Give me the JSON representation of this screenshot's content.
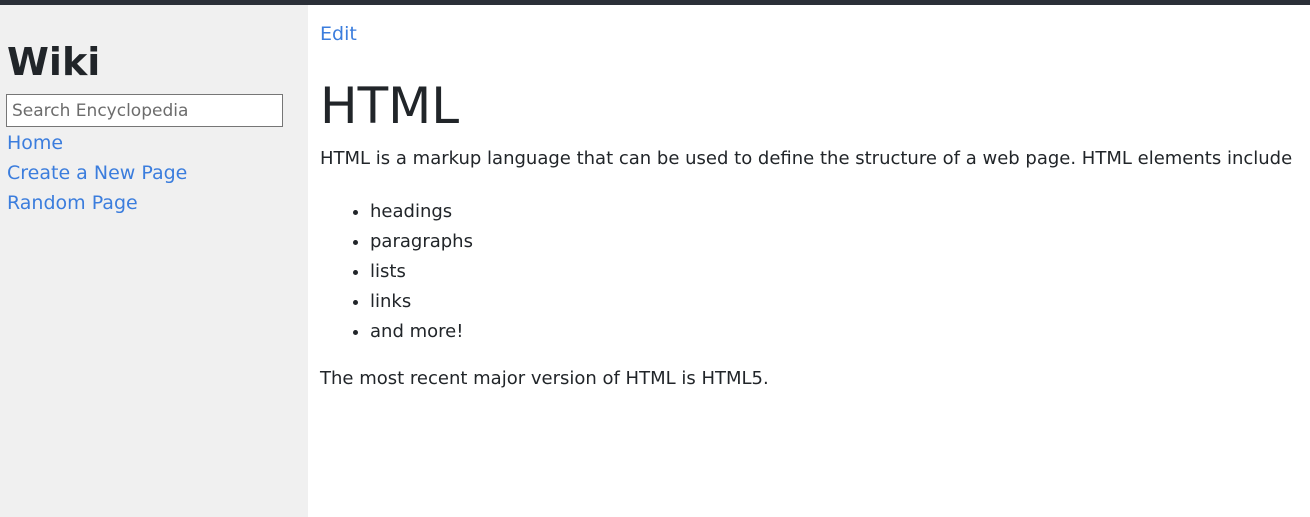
{
  "sidebar": {
    "title": "Wiki",
    "search_placeholder": "Search Encyclopedia",
    "nav": [
      {
        "label": "Home"
      },
      {
        "label": "Create a New Page"
      },
      {
        "label": "Random Page"
      }
    ]
  },
  "main": {
    "edit_label": "Edit",
    "title": "HTML",
    "intro": "HTML is a markup language that can be used to define the structure of a web page. HTML elements include",
    "list": [
      "headings",
      "paragraphs",
      "lists",
      "links",
      "and more!"
    ],
    "closing": "The most recent major version of HTML is HTML5."
  },
  "colors": {
    "link": "#3b7ddd",
    "sidebar_bg": "#f0f0f0",
    "topbar": "#2b2f38",
    "text": "#212529"
  }
}
